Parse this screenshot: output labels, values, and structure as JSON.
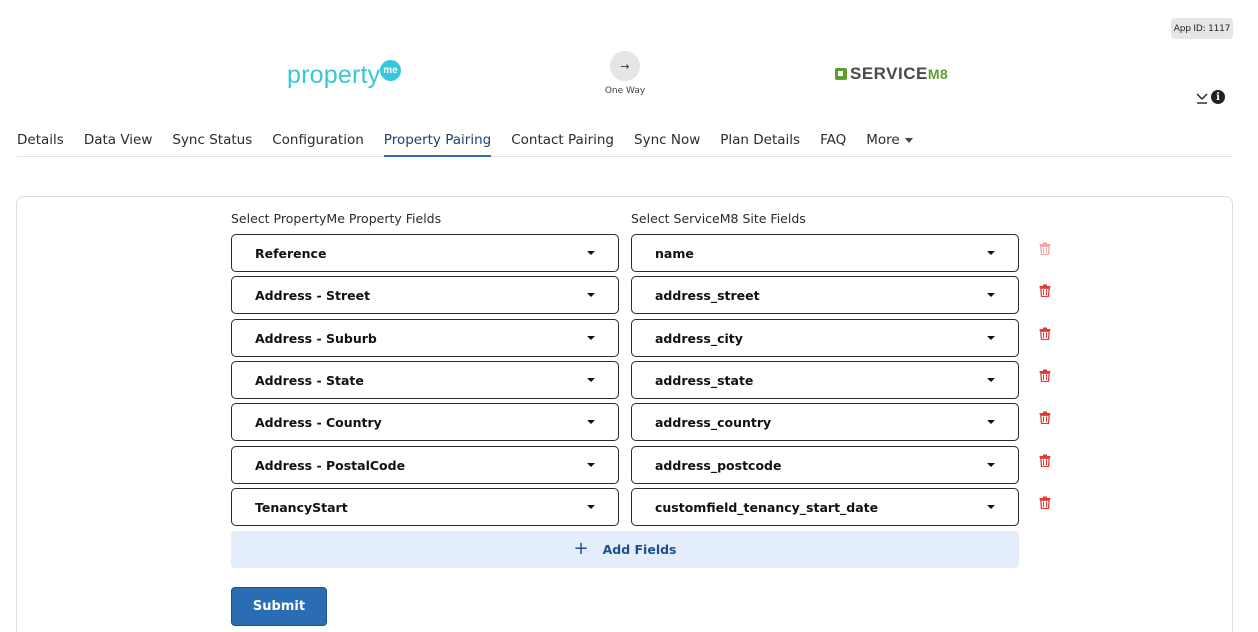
{
  "app_id": "App ID: 1117",
  "logos": {
    "left": {
      "text": "property",
      "bubble": "me"
    },
    "right": {
      "text": "SERVICE",
      "suffix": "M8"
    }
  },
  "direction": {
    "label": "One Way",
    "arrow": "→"
  },
  "tabs": [
    {
      "label": "Details"
    },
    {
      "label": "Data View"
    },
    {
      "label": "Sync Status"
    },
    {
      "label": "Configuration"
    },
    {
      "label": "Property Pairing",
      "active": true
    },
    {
      "label": "Contact Pairing"
    },
    {
      "label": "Sync Now"
    },
    {
      "label": "Plan Details"
    },
    {
      "label": "FAQ"
    },
    {
      "label": "More"
    }
  ],
  "pairing": {
    "left_header": "Select PropertyMe Property Fields",
    "right_header": "Select ServiceM8 Site Fields",
    "rows": [
      {
        "left": "Reference",
        "right": "name",
        "delete_disabled": true
      },
      {
        "left": "Address - Street",
        "right": "address_street"
      },
      {
        "left": "Address - Suburb",
        "right": "address_city"
      },
      {
        "left": "Address - State",
        "right": "address_state"
      },
      {
        "left": "Address - Country",
        "right": "address_country"
      },
      {
        "left": "Address - PostalCode",
        "right": "address_postcode"
      },
      {
        "left": "TenancyStart",
        "right": "customfield_tenancy_start_date"
      }
    ],
    "add_label": "Add Fields",
    "submit_label": "Submit"
  },
  "colors": {
    "accent": "#2a6db5",
    "delete": "#e53935",
    "delete_disabled": "#f2a3a3",
    "pme_brand": "#38c6d9",
    "sm8_brand": "#5aa02c"
  }
}
